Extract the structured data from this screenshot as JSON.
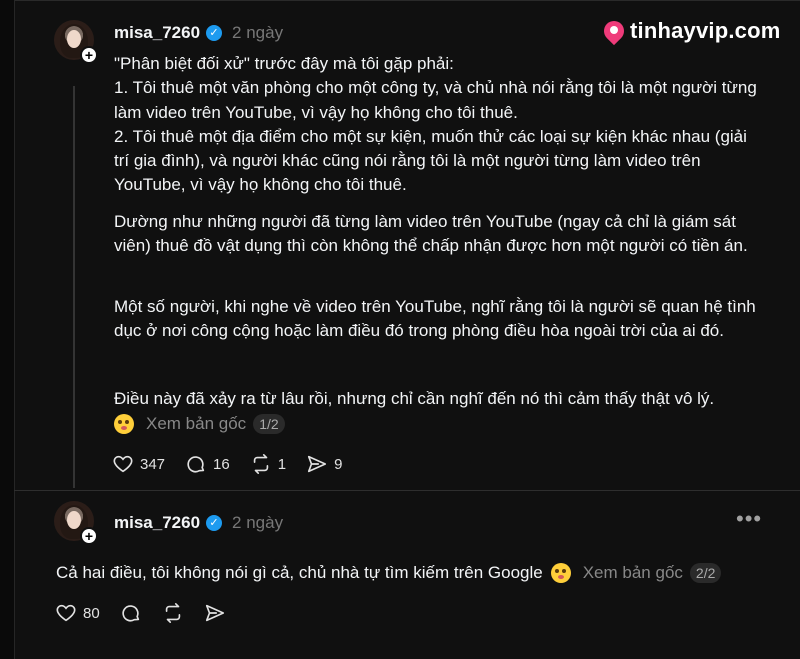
{
  "brand": {
    "name": "tinhayvip.com",
    "color": "#ef3b7a"
  },
  "post": {
    "username": "misa_7260",
    "time": "2 ngày",
    "paragraphs": [
      "\"Phân biệt đối xử\" trước đây mà tôi gặp phải:\n1. Tôi thuê một văn phòng cho một công ty, và chủ nhà nói rằng tôi là một người từng làm video trên YouTube, vì vậy họ không cho tôi thuê.\n2. Tôi thuê một địa điểm cho một sự kiện, muốn thử các loại sự kiện khác nhau (giải trí gia đình), và người khác cũng nói rằng tôi là một người từng làm video trên YouTube, vì vậy họ không cho tôi thuê.",
      "Dường như những người đã từng làm video trên YouTube (ngay cả chỉ là giám sát viên) thuê đồ vật dụng thì còn không thể chấp nhận được hơn một người có tiền án.",
      "Một số người, khi nghe về video trên YouTube, nghĩ rằng tôi là người sẽ quan hệ tình dục ở nơi công cộng hoặc làm điều đó trong phòng điều hòa ngoài trời của ai đó.",
      "Điều này đã xảy ra từ lâu rồi, nhưng chỉ cần nghĩ đến nó thì cảm thấy thật vô lý."
    ],
    "see_original": "Xem bản gốc",
    "pager": "1/2",
    "likes": "347",
    "comments": "16",
    "reposts": "1",
    "shares": "9"
  },
  "reply": {
    "username": "misa_7260",
    "time": "2 ngày",
    "text": "Cả hai điều, tôi không nói gì cả, chủ nhà tự tìm kiếm trên Google",
    "see_original": "Xem bản gốc",
    "pager": "2/2",
    "likes": "80"
  },
  "icons": {
    "verified": "verified-badge-icon",
    "like": "heart-icon",
    "comment": "comment-icon",
    "repost": "repost-icon",
    "share": "share-icon",
    "more": "more-icon",
    "emoji": "flushed-face-emoji-icon"
  }
}
